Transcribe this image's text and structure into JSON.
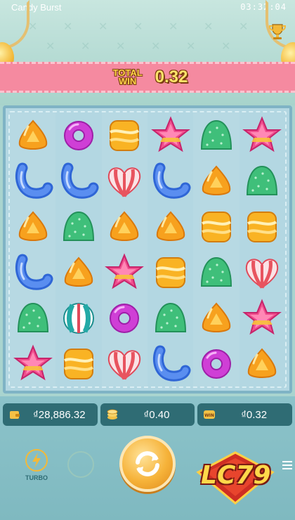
{
  "status_bar": {
    "title": "Candy Burst",
    "time": "03:32:04"
  },
  "win_banner": {
    "label": "TOTAL WIN",
    "value": "0.32"
  },
  "board": {
    "rows": [
      [
        "orange-drop",
        "purple-ring",
        "yellow-jelly",
        "pink-star",
        "green-gumdrop",
        "pink-star"
      ],
      [
        "blue-worm",
        "blue-worm",
        "striped-heart",
        "blue-worm",
        "orange-drop",
        "green-gumdrop"
      ],
      [
        "orange-drop",
        "green-gumdrop",
        "orange-drop",
        "orange-drop",
        "yellow-jelly",
        "yellow-jelly"
      ],
      [
        "blue-worm",
        "orange-drop",
        "pink-star",
        "yellow-jelly",
        "green-gumdrop",
        "striped-heart"
      ],
      [
        "green-gumdrop",
        "striped-ball",
        "purple-ring",
        "green-gumdrop",
        "orange-drop",
        "pink-star"
      ],
      [
        "pink-star",
        "yellow-jelly",
        "striped-heart",
        "blue-worm",
        "purple-ring",
        "orange-drop"
      ]
    ]
  },
  "info_bar": {
    "balance": {
      "icon": "wallet-icon",
      "value": "₫28,886.32"
    },
    "bet": {
      "icon": "coins-icon",
      "value": "₫0.40"
    },
    "win": {
      "icon": "win-icon",
      "value": "₫0.32"
    }
  },
  "controls": {
    "turbo_label": "TURBO",
    "logo_text": "LC79"
  },
  "colors": {
    "accent": "#f6b33a",
    "banner": "#f58aa0",
    "panel": "#2f6c74"
  }
}
